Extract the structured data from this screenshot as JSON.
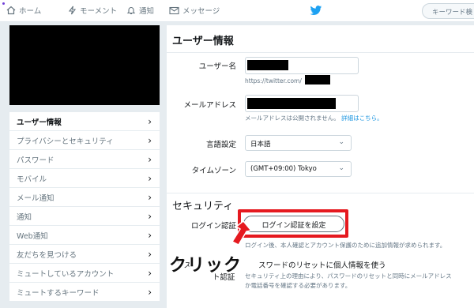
{
  "nav": {
    "home": "ホーム",
    "moments": "モーメント",
    "notifications": "通知",
    "messages": "メッセージ",
    "search_placeholder": "キーワード検"
  },
  "sidebar": {
    "items": [
      {
        "label": "ユーザー情報",
        "active": true
      },
      {
        "label": "プライバシーとセキュリティ"
      },
      {
        "label": "パスワード"
      },
      {
        "label": "モバイル"
      },
      {
        "label": "メール通知"
      },
      {
        "label": "通知"
      },
      {
        "label": "Web通知"
      },
      {
        "label": "友だちを見つける"
      },
      {
        "label": "ミュートしているアカウント"
      },
      {
        "label": "ミュートするキーワード"
      }
    ],
    "chevron": "›"
  },
  "main": {
    "title": "ユーザー情報",
    "username_label": "ユーザー名",
    "url_prefix": "https://twitter.com/",
    "email_label": "メールアドレス",
    "email_help": "メールアドレスは公開されません。",
    "email_help_link": "詳細はこちら。",
    "language_label": "言語設定",
    "language_value": "日本語",
    "timezone_label": "タイムゾーン",
    "timezone_value": "(GMT+09:00) Tokyo",
    "security_title": "セキュリティ",
    "login_verify_label": "ログイン認証",
    "login_verify_button": "ログイン認証を設定",
    "login_verify_note": "ログイン後、本人確認とアカウント保護のために追加情報が求められます。",
    "password_reset_label_1": "パス",
    "password_reset_label_2": "ト認証",
    "password_reset_title": "スワードのリセットに個人情報を使う",
    "password_reset_note_1": "セキュリティ上の理由により、パスワードのリセットと同時にメールアドレス",
    "password_reset_note_2": "か電話番号を確認する必要があります。"
  },
  "annotation": {
    "click_label": "クリック",
    "highlight_color": "#e5191f"
  },
  "colors": {
    "accent": "#1da1f2",
    "link": "#1b95e0",
    "background": "#e6ecf0"
  }
}
